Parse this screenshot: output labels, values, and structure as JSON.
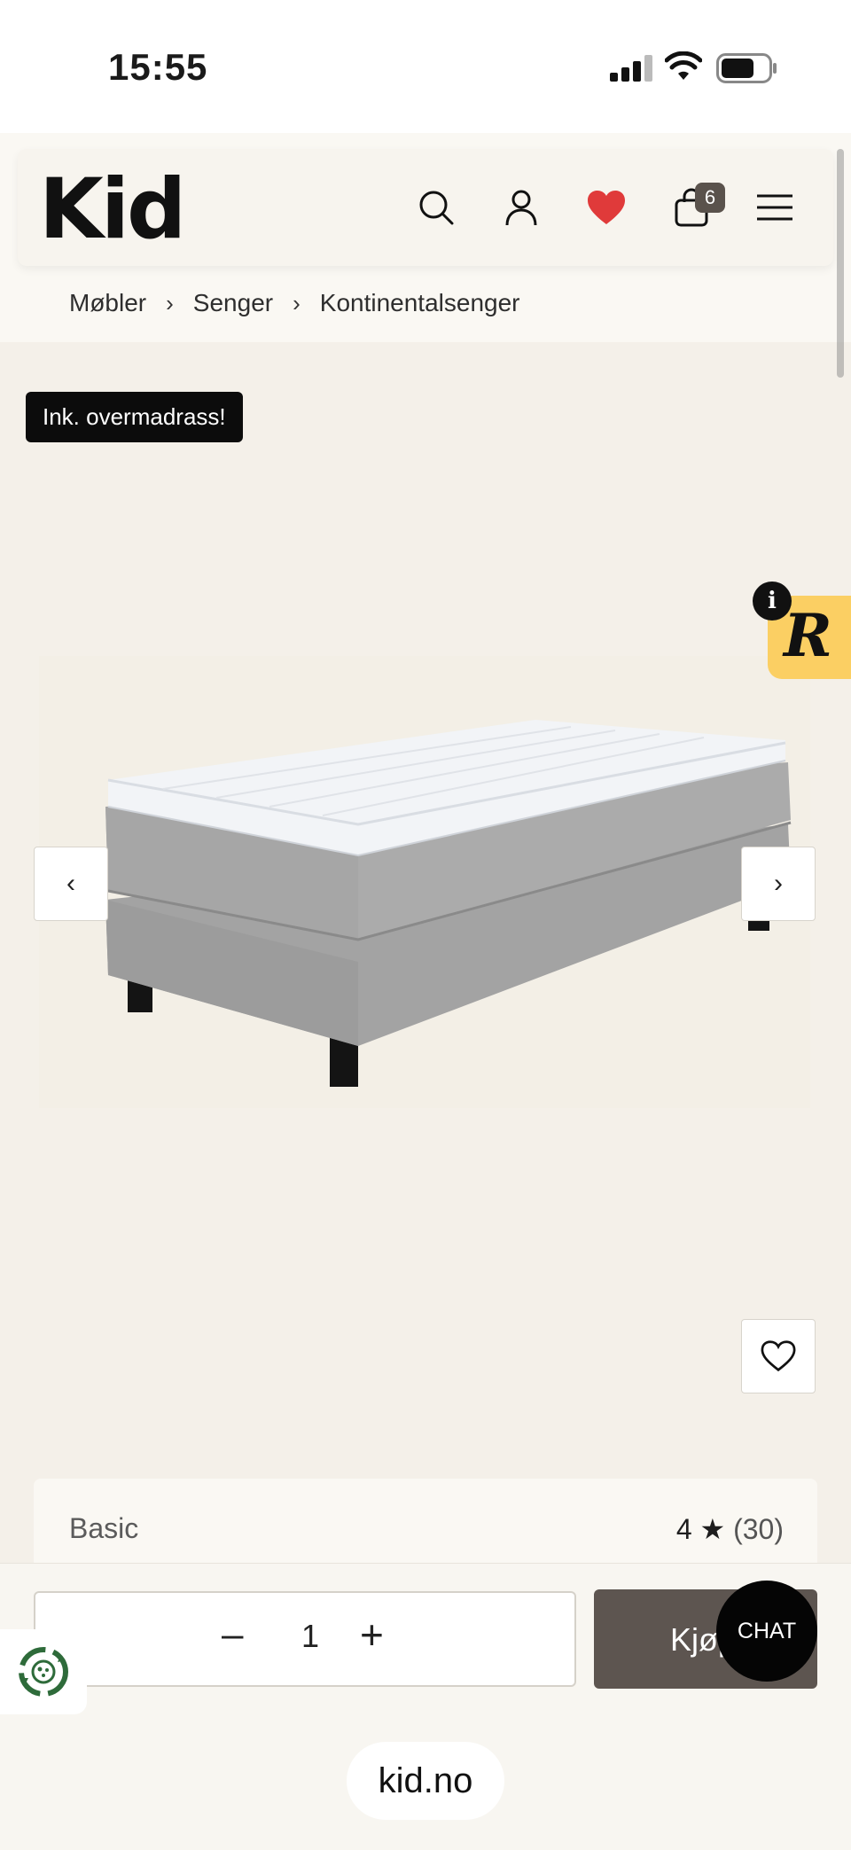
{
  "status_bar": {
    "time": "15:55"
  },
  "header": {
    "logo": "Kid",
    "cart_count": "6",
    "icons": [
      "search-icon",
      "user-icon",
      "heart-icon",
      "cart-icon",
      "menu-icon"
    ],
    "heart_color": "#e03a3a"
  },
  "breadcrumb": {
    "items": [
      "Møbler",
      "Senger",
      "Kontinentalsenger"
    ],
    "separator": "›"
  },
  "product": {
    "badge": "Ink. overmadrass!",
    "brand": "Basic",
    "rating": "4 ★",
    "reviews": "(30)",
    "image_alt": "bed-image"
  },
  "carousel": {
    "prev": "‹",
    "next": "›"
  },
  "floating": {
    "info": "i",
    "r_logo": "R"
  },
  "purchase": {
    "quantity": "1",
    "minus": "–",
    "plus": "+",
    "buy_label": "Kjøp"
  },
  "chat": {
    "label": "CHAT"
  },
  "browser": {
    "url": "kid.no"
  },
  "colors": {
    "background": "#f4f0e9",
    "buy_button": "#5d5550",
    "r_badge": "#fbcf63"
  }
}
